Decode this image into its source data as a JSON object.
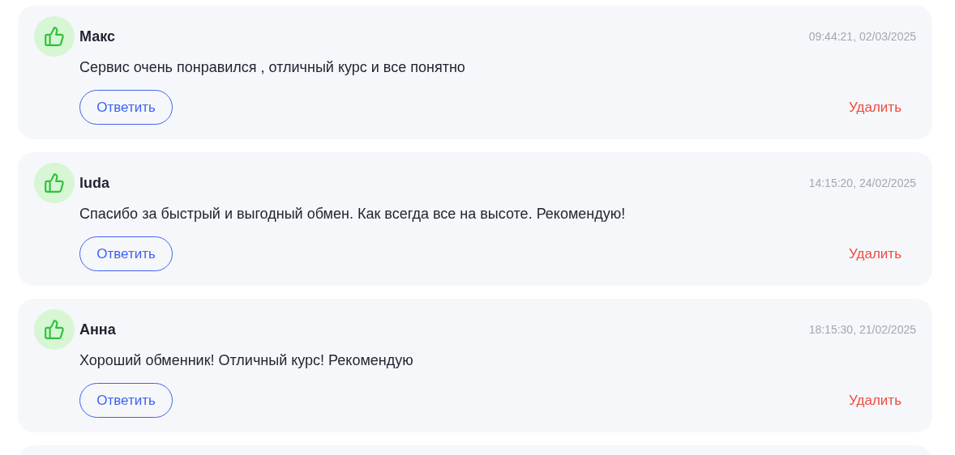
{
  "reviews": [
    {
      "author": "Макс",
      "time": "09:44:21, 02/03/2025",
      "text": "Сервис очень понравился , отличный курс и все понятно",
      "reply": "Ответить",
      "delete": "Удалить",
      "positive": true
    },
    {
      "author": "luda",
      "time": "14:15:20, 24/02/2025",
      "text": "Спасибо за быстрый и выгодный обмен. Как всегда все на высоте. Рекомендую!",
      "reply": "Ответить",
      "delete": "Удалить",
      "positive": true
    },
    {
      "author": "Анна",
      "time": "18:15:30, 21/02/2025",
      "text": "Хороший обменник! Отличный курс! Рекомендую",
      "reply": "Ответить",
      "delete": "Удалить",
      "positive": true
    }
  ]
}
